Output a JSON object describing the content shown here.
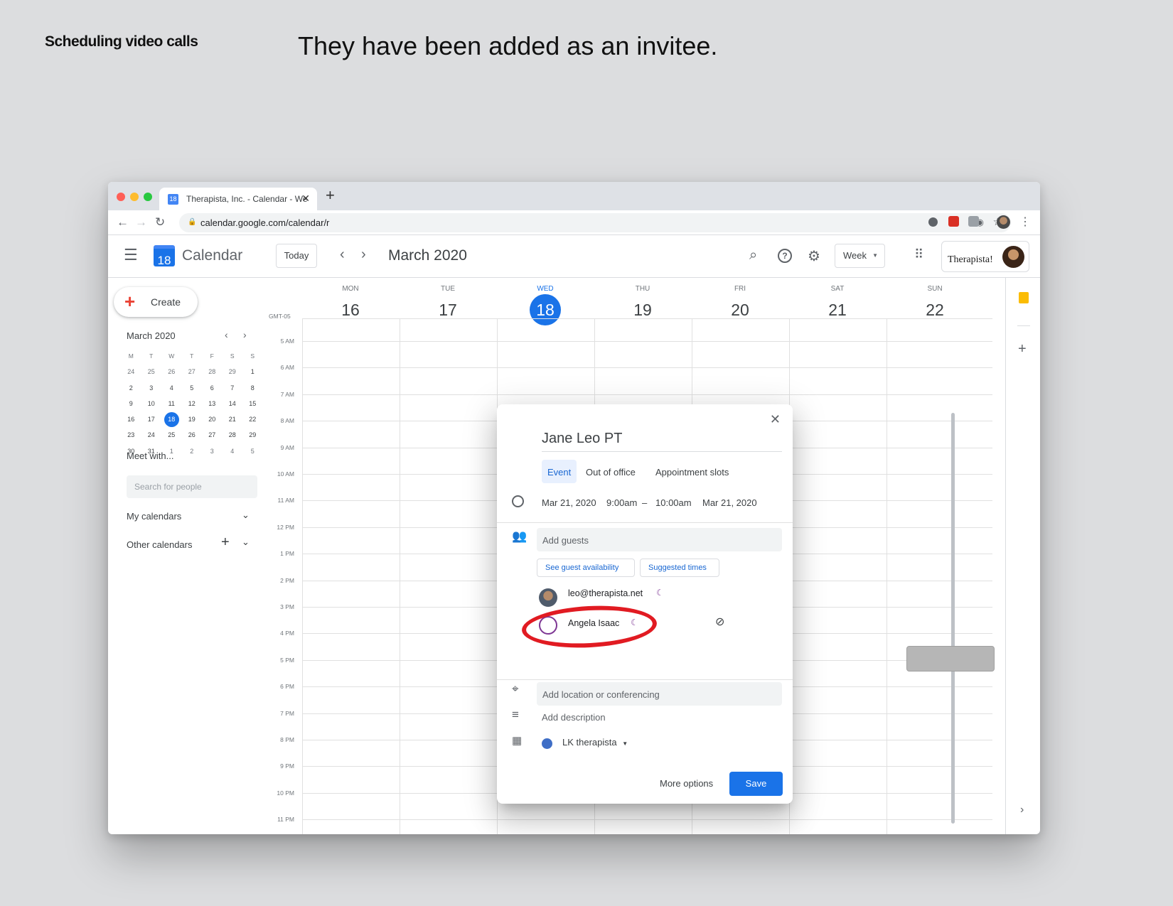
{
  "slide": {
    "label": "Scheduling video calls",
    "title": "They have been added as an invitee."
  },
  "browser": {
    "tab_title": "Therapista, Inc. - Calendar - We",
    "favicon_text": "18",
    "url": "calendar.google.com/calendar/r",
    "traffic_lights": [
      "#ff5f57",
      "#febc2e",
      "#28c840"
    ]
  },
  "header": {
    "logo_num": "18",
    "app_title": "Calendar",
    "today_label": "Today",
    "month_title": "March 2020",
    "view_label": "Week",
    "brand_text": "Therapista!"
  },
  "sidebar": {
    "create_label": "Create",
    "mini_month": "March 2020",
    "weekday_heads": [
      "M",
      "T",
      "W",
      "T",
      "F",
      "S",
      "S"
    ],
    "mini_days": [
      [
        "24",
        "25",
        "26",
        "27",
        "28",
        "29",
        "1"
      ],
      [
        "2",
        "3",
        "4",
        "5",
        "6",
        "7",
        "8"
      ],
      [
        "9",
        "10",
        "11",
        "12",
        "13",
        "14",
        "15"
      ],
      [
        "16",
        "17",
        "18",
        "19",
        "20",
        "21",
        "22"
      ],
      [
        "23",
        "24",
        "25",
        "26",
        "27",
        "28",
        "29"
      ],
      [
        "30",
        "31",
        "1",
        "2",
        "3",
        "4",
        "5"
      ]
    ],
    "today_mini": "18",
    "meet_with": "Meet with...",
    "search_placeholder": "Search for people",
    "my_calendars": "My calendars",
    "other_calendars": "Other calendars"
  },
  "week": {
    "timezone": "GMT-05",
    "days": [
      {
        "name": "MON",
        "num": "16"
      },
      {
        "name": "TUE",
        "num": "17"
      },
      {
        "name": "WED",
        "num": "18",
        "today": true
      },
      {
        "name": "THU",
        "num": "19"
      },
      {
        "name": "FRI",
        "num": "20"
      },
      {
        "name": "SAT",
        "num": "21"
      },
      {
        "name": "SUN",
        "num": "22"
      }
    ],
    "times": [
      "5 AM",
      "6 AM",
      "7 AM",
      "8 AM",
      "9 AM",
      "10 AM",
      "11 AM",
      "12 PM",
      "1 PM",
      "2 PM",
      "3 PM",
      "4 PM",
      "5 PM",
      "6 PM",
      "7 PM",
      "8 PM",
      "9 PM",
      "10 PM",
      "11 PM"
    ]
  },
  "dialog": {
    "title": "Jane Leo PT",
    "tabs": [
      "Event",
      "Out of office",
      "Appointment slots"
    ],
    "start_date": "Mar 21, 2020",
    "start_time": "9:00am",
    "dash": "–",
    "end_time": "10:00am",
    "end_date": "Mar 21, 2020",
    "add_guests": "Add guests",
    "see_availability": "See guest availability",
    "suggested_times": "Suggested times",
    "guests": [
      {
        "name": "leo@therapista.net"
      },
      {
        "name": "Angela Isaac"
      }
    ],
    "location_placeholder": "Add location or conferencing",
    "description_placeholder": "Add description",
    "calendar_name": "LK therapista",
    "calendar_color": "#3f6ec6",
    "more_options": "More options",
    "save": "Save"
  },
  "colors": {
    "accent": "#1a73e8",
    "highlight_ring": "#e11b22"
  }
}
